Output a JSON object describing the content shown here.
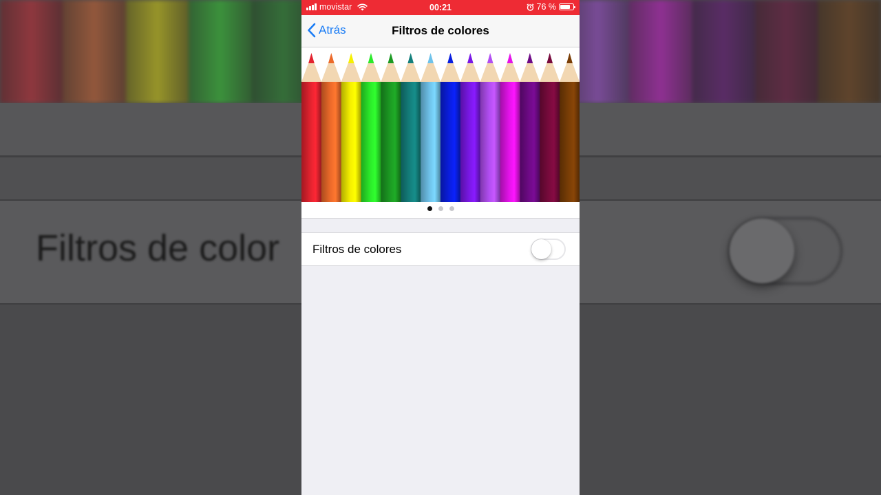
{
  "status_bar": {
    "carrier": "movistar",
    "time": "00:21",
    "battery_text": "76 %",
    "battery_level": 0.76
  },
  "nav": {
    "back_label": "Atrás",
    "title": "Filtros de colores"
  },
  "preview": {
    "pencil_colors": [
      "#e3232f",
      "#ec6a2a",
      "#f6f000",
      "#2bea2a",
      "#1c9a23",
      "#147f7c",
      "#6fc2ea",
      "#0a1ee0",
      "#7a18e6",
      "#b24ef2",
      "#e313e9",
      "#6e0a86",
      "#780a3c",
      "#7a3e06"
    ],
    "page_count": 3,
    "current_page": 0
  },
  "setting": {
    "label": "Filtros de colores",
    "enabled": false
  },
  "background": {
    "label": "Filtros de color"
  }
}
